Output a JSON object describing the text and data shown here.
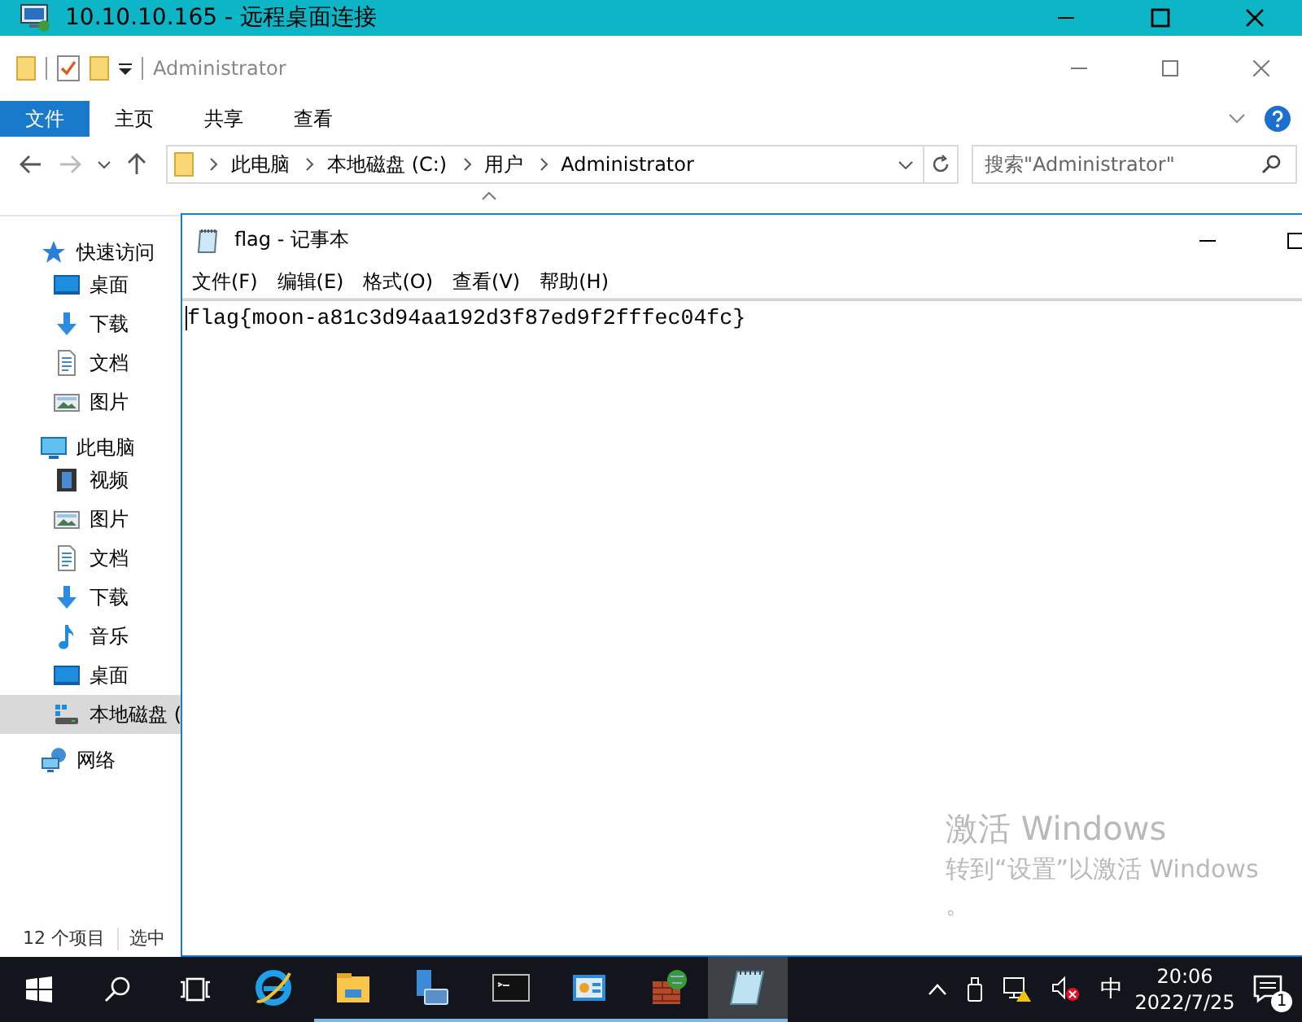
{
  "rdp_window": {
    "title": "10.10.10.165 - 远程桌面连接"
  },
  "explorer": {
    "title": "Administrator",
    "ribbon_tabs": [
      {
        "label": "文件",
        "selected": true
      },
      {
        "label": "主页",
        "selected": false
      },
      {
        "label": "共享",
        "selected": false
      },
      {
        "label": "查看",
        "selected": false
      }
    ],
    "breadcrumb": [
      "此电脑",
      "本地磁盘 (C:)",
      "用户",
      "Administrator"
    ],
    "search": {
      "placeholder": "搜索\"Administrator\""
    },
    "nav": [
      {
        "label": "快速访问",
        "selected": false,
        "children": [
          {
            "label": "桌面",
            "selected": false
          },
          {
            "label": "下载",
            "selected": false
          },
          {
            "label": "文档",
            "selected": false
          },
          {
            "label": "图片",
            "selected": false
          }
        ]
      },
      {
        "label": "此电脑",
        "selected": false,
        "children": [
          {
            "label": "视频",
            "selected": false
          },
          {
            "label": "图片",
            "selected": false
          },
          {
            "label": "文档",
            "selected": false
          },
          {
            "label": "下载",
            "selected": false
          },
          {
            "label": "音乐",
            "selected": false
          },
          {
            "label": "桌面",
            "selected": false
          },
          {
            "label": "本地磁盘 (",
            "selected": true
          }
        ]
      },
      {
        "label": "网络",
        "selected": false
      }
    ],
    "status_bar": [
      "12 个项目",
      "选中"
    ]
  },
  "notepad": {
    "title": "flag - 记事本",
    "menu": [
      "文件(F)",
      "编辑(E)",
      "格式(O)",
      "查看(V)",
      "帮助(H)"
    ],
    "content": "flag{moon-a81c3d94aa192d3f87ed9f2fffec04fc}"
  },
  "activation": {
    "title": "激活 Windows",
    "text": "转到“设置”以激活 Windows",
    "line_2": "。"
  },
  "taskbar": {
    "apps": [
      {
        "kind": "ie",
        "running": false,
        "selected": false
      },
      {
        "kind": "explorer",
        "running": true,
        "selected": false
      },
      {
        "kind": "server",
        "running": true,
        "selected": false
      },
      {
        "kind": "cmd",
        "running": true,
        "selected": false
      },
      {
        "kind": "panel",
        "running": true,
        "selected": false
      },
      {
        "kind": "firewall",
        "running": true,
        "selected": false
      },
      {
        "kind": "notepad",
        "running": true,
        "selected": true
      }
    ],
    "ime": "中",
    "time": "20:06",
    "date": "2022/7/25",
    "notifications": "1"
  }
}
